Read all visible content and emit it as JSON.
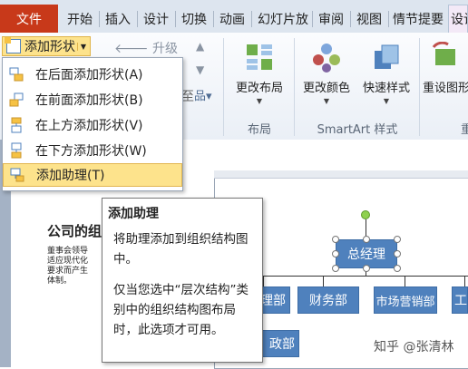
{
  "tabs": {
    "file": "文件",
    "items": [
      "开始",
      "插入",
      "设计",
      "切换",
      "动画",
      "幻灯片放",
      "审阅",
      "视图",
      "情节提要",
      "设计"
    ]
  },
  "ribbon": {
    "add_shape": "添加形状",
    "promote": "升级",
    "change_layout": "更改布局",
    "change_colors": "更改颜色",
    "quick_styles": "快速样式",
    "reset_graphic": "重设图形",
    "group_layout": "布局",
    "group_smartart_styles": "SmartArt 样式",
    "group_reset_partial": "重"
  },
  "menu": [
    {
      "label": "在后面添加形状(A)",
      "icon": "shape-after-icon"
    },
    {
      "label": "在前面添加形状(B)",
      "icon": "shape-before-icon"
    },
    {
      "label": "在上方添加形状(V)",
      "icon": "shape-above-icon"
    },
    {
      "label": "在下方添加形状(W)",
      "icon": "shape-below-icon"
    },
    {
      "label": "添加助理(T)",
      "icon": "add-assistant-icon"
    }
  ],
  "tooltip": {
    "title": "添加助理",
    "p1": "将助理添加到组织结构图中。",
    "p2": "仅当您选中“层次结构”类别中的组织结构图布局时，此选项才可用。"
  },
  "slide": {
    "title_partial": "公司的组",
    "body_lines": [
      "董事会领导",
      "适应现代化",
      "要求而产生",
      "体制。"
    ]
  },
  "org": {
    "top": "总经理",
    "row": [
      "理部",
      "财务部",
      "市场营销部",
      "工程"
    ],
    "bottom_partial": "政部"
  },
  "watermark": "知乎 @张清林",
  "colors": {
    "accent": "#4f81bd",
    "file_tab": "#c8391a",
    "highlight": "#fde38c"
  }
}
